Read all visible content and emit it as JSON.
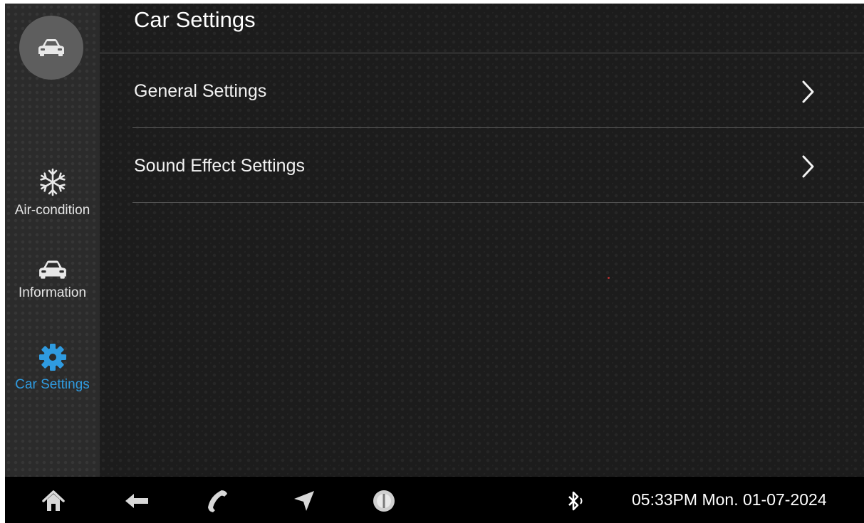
{
  "sidebar": {
    "home_icon": "car-icon",
    "items": [
      {
        "label": "Air-condition",
        "icon": "snowflake-icon",
        "active": false
      },
      {
        "label": "Information",
        "icon": "car-icon",
        "active": false
      },
      {
        "label": "Car Settings",
        "icon": "gear-icon",
        "active": true
      }
    ]
  },
  "main": {
    "title": "Car Settings",
    "menu": [
      {
        "label": "General Settings",
        "icon": "chevron-right-icon"
      },
      {
        "label": "Sound Effect Settings",
        "icon": "chevron-right-icon"
      }
    ]
  },
  "taskbar": {
    "icons": [
      "home-icon",
      "back-arrow-icon",
      "phone-icon",
      "navigation-icon",
      "media-icon",
      "bluetooth-icon"
    ],
    "datetime": "05:33PM Mon. 01-07-2024"
  },
  "colors": {
    "accent": "#2f9be0",
    "background": "#1c1c1c",
    "sidebar": "#2b2b2b",
    "taskbar": "#000000"
  }
}
